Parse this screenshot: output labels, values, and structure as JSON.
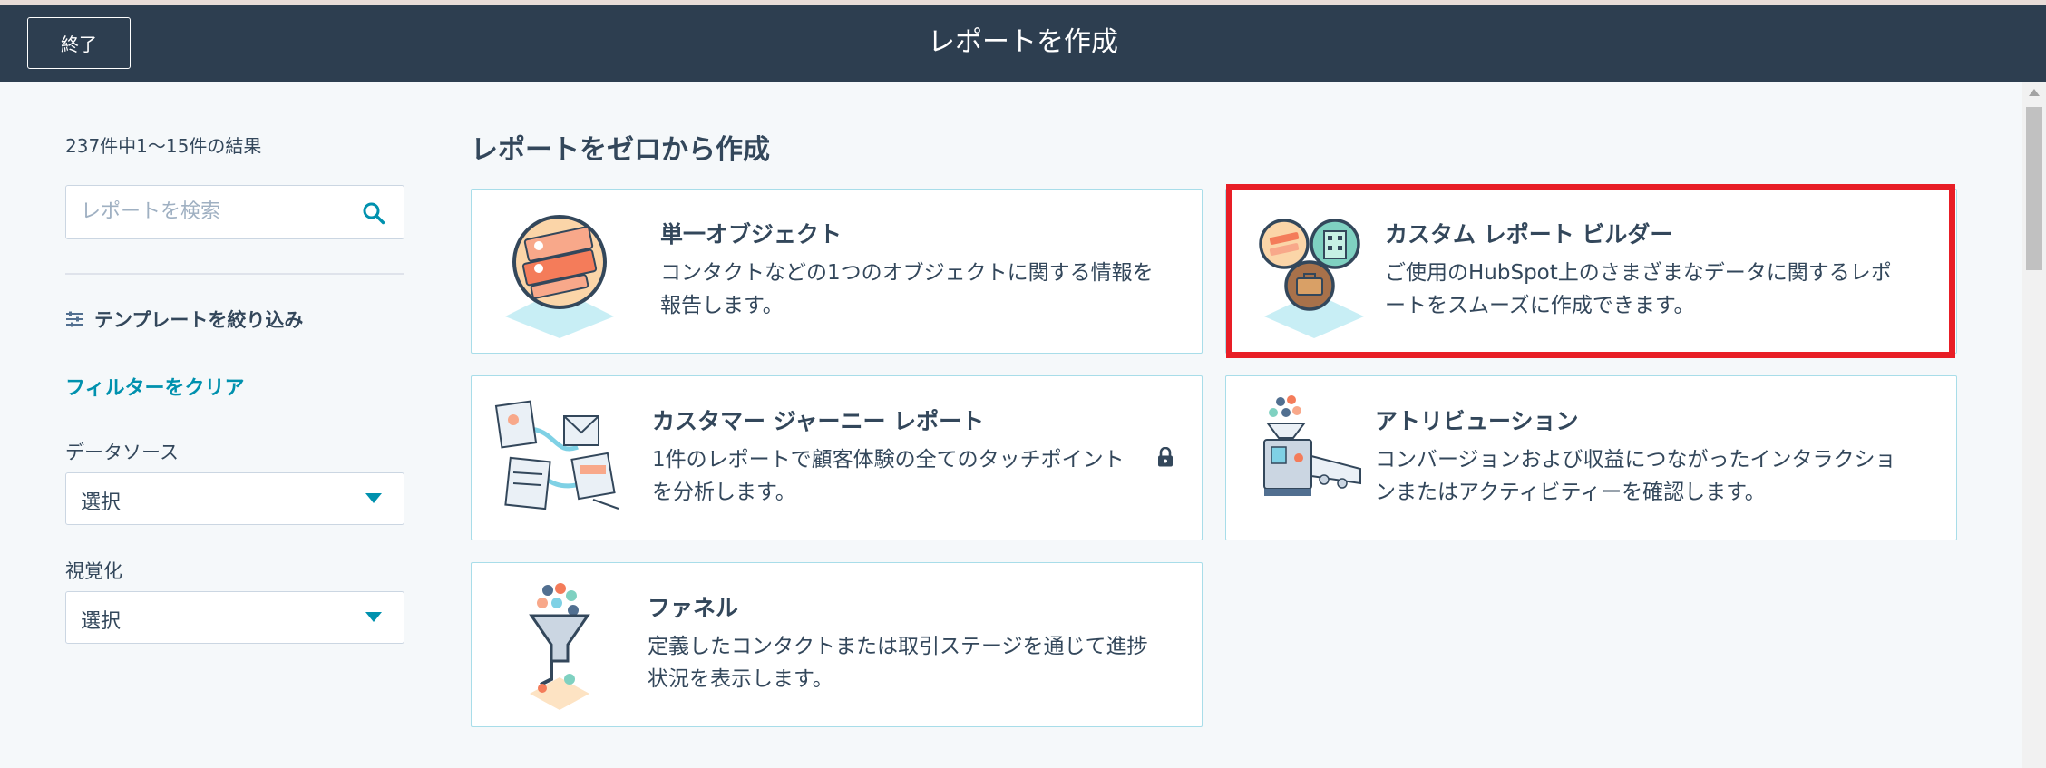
{
  "header": {
    "exit_label": "終了",
    "title": "レポートを作成"
  },
  "sidebar": {
    "result_count": "237件中1～15件の結果",
    "search": {
      "placeholder": "レポートを検索",
      "value": "",
      "icon": "search-icon"
    },
    "filter_heading": "テンプレートを絞り込み",
    "filter_icon": "sliders-icon",
    "clear_filters": "フィルターをクリア",
    "data_source": {
      "label": "データソース",
      "selected": "選択"
    },
    "visualization": {
      "label": "視覚化",
      "selected": "選択"
    }
  },
  "main": {
    "section_title": "レポートをゼロから作成",
    "cards": [
      {
        "title": "単一オブジェクト",
        "description": [
          "コンタクトなどの1つのオブジェクトに関する情報を",
          "報告します。"
        ],
        "icon": "single-object-illustration"
      },
      {
        "title": "カスタム レポート ビルダー",
        "description": [
          "ご使用のHubSpot上のさまざまなデータに関するレポ",
          "ートをスムーズに作成できます。"
        ],
        "icon": "custom-report-builder-illustration",
        "highlighted": true
      },
      {
        "title": "カスタマー ジャーニー レポート",
        "description": [
          "1件のレポートで顧客体験の全てのタッチポイント",
          "を分析します。"
        ],
        "icon": "customer-journey-illustration",
        "locked": true
      },
      {
        "title": "アトリビューション",
        "description": [
          "コンバージョンおよび収益につながったインタラクショ",
          "ンまたはアクティビティーを確認します。"
        ],
        "icon": "attribution-illustration"
      },
      {
        "title": "ファネル",
        "description": [
          "定義したコンタクトまたは取引ステージを通じて進捗",
          "状況を表示します。"
        ],
        "icon": "funnel-illustration"
      }
    ]
  },
  "colors": {
    "header_bg": "#2d3e50",
    "card_border": "#a8dde9",
    "link": "#0091ae",
    "highlight": "#e81e26",
    "text": "#33475b"
  }
}
